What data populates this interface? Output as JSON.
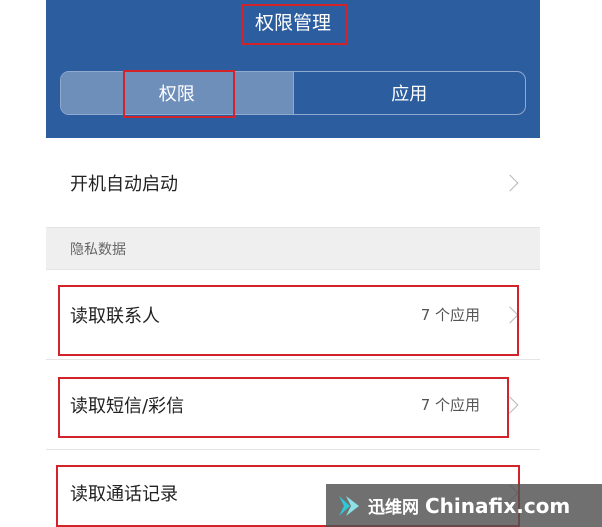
{
  "header": {
    "title": "权限管理",
    "tabs": [
      {
        "label": "权限",
        "active": true
      },
      {
        "label": "应用",
        "active": false
      }
    ]
  },
  "rows": {
    "autostart": {
      "label": "开机自动启动"
    },
    "section_privacy": "隐私数据",
    "contacts": {
      "label": "读取联系人",
      "count": "7 个应用"
    },
    "sms": {
      "label": "读取短信/彩信",
      "count": "7 个应用"
    },
    "call_log": {
      "label": "读取通话记录"
    }
  },
  "watermark": {
    "brand": "迅维网",
    "site": "Chinafix.com"
  },
  "colors": {
    "header_bg": "#2c5d9e",
    "highlight": "#d3232a"
  }
}
